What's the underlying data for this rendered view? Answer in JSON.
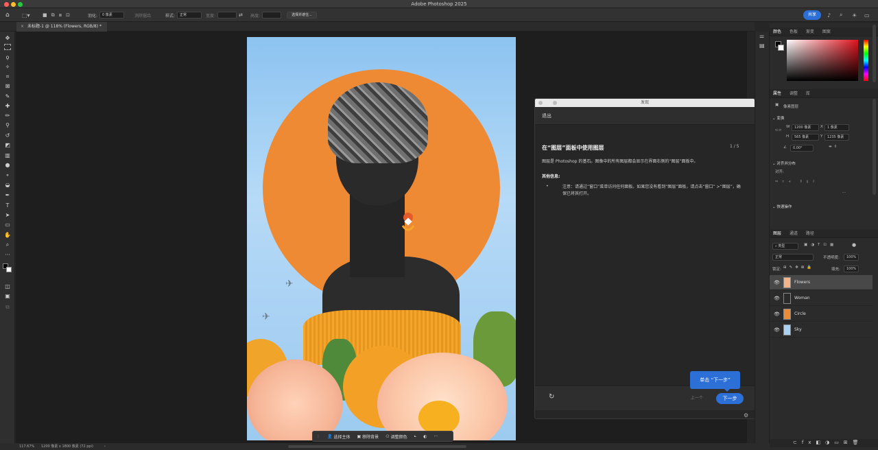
{
  "window": {
    "title": "Adobe Photoshop 2025",
    "document_tab": "未标题-1 @ 118% (Flowers, RGB/8) *"
  },
  "options_bar": {
    "feather_label": "羽化:",
    "feather_value": "0 像素",
    "antialias_label": "消除锯齿",
    "style_label": "样式:",
    "style_value": "正常",
    "width_label": "宽度:",
    "height_label": "高度:",
    "select_mask_label": "选择并遮住...",
    "share_label": "共享"
  },
  "learn_panel": {
    "header": "发现",
    "exit_label": "退出",
    "title": "在“图层”面板中使用图层",
    "step": "1 / 5",
    "body": "图层是 Photoshop 的基石。图像中的所有图层都会显示在界面右侧的“图层”面板中。",
    "info_heading": "其他信息:",
    "note": "注意：请通过“窗口”菜单访问任何面板。如果您没有看到“图层”面板，请点击“窗口” >“图层”，确保已将其打开。",
    "prev_label": "上一个",
    "next_label": "下一步",
    "tooltip": "单击 “下一步”"
  },
  "context_bar": {
    "select_subject": "选择主体",
    "remove_bg": "移除背景",
    "adjust_color": "调整颜色"
  },
  "status_bar": {
    "zoom": "117.67%",
    "dimensions": "1200 像素 x 1800 像素 (72 ppi)"
  },
  "color_panel": {
    "tabs": [
      "颜色",
      "色板",
      "渐变",
      "图案"
    ]
  },
  "properties_panel": {
    "tabs": [
      "属性",
      "调整",
      "库"
    ],
    "layer_type": "像素图层",
    "transform_label": "变换",
    "w_label": "W",
    "w_value": "1200 像素",
    "x_label": "X",
    "x_value": "1 像素",
    "h_label": "H",
    "h_value": "565 像素",
    "y_label": "Y",
    "y_value": "1235 像素",
    "angle_value": "0.00°",
    "align_label": "对齐并分布",
    "align_sub": "对齐:",
    "quick_actions": "快速操作"
  },
  "layers_panel": {
    "tabs": [
      "图层",
      "通道",
      "路径"
    ],
    "filter_label": "类型",
    "blend_mode": "正常",
    "opacity_label": "不透明度:",
    "opacity_value": "100%",
    "lock_label": "锁定:",
    "fill_label": "填充:",
    "fill_value": "100%",
    "layers": [
      {
        "name": "Flowers",
        "thumb_color": "#f4b48a",
        "selected": true
      },
      {
        "name": "Woman",
        "thumb_color": "#2a2a2a",
        "selected": false
      },
      {
        "name": "Circle",
        "thumb_color": "#ef8a34",
        "selected": false
      },
      {
        "name": "Sky",
        "thumb_color": "#a9d1f3",
        "selected": false
      }
    ]
  },
  "colors": {
    "accent": "#2c6fd6",
    "sun": "#ef8a34",
    "sky": "#a9d1f3"
  }
}
